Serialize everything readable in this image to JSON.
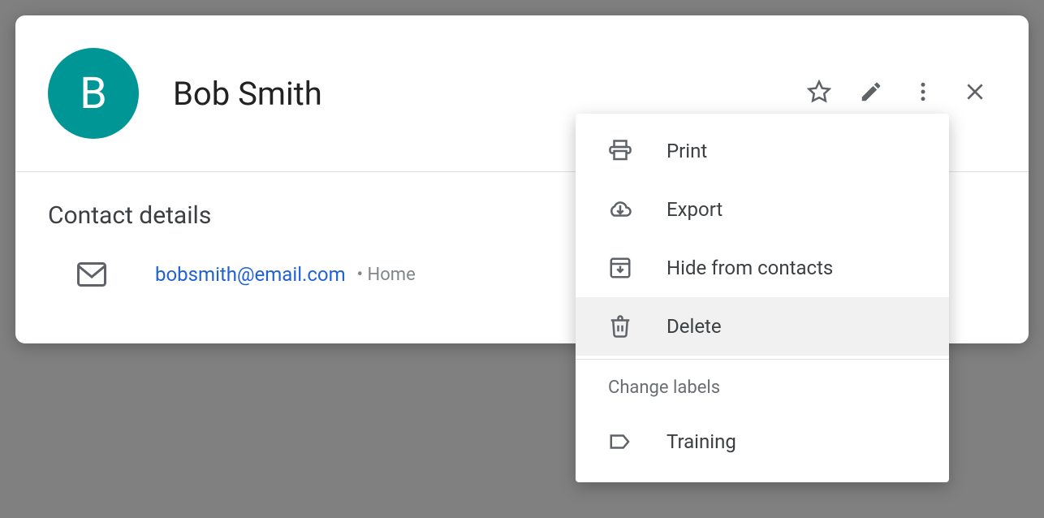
{
  "contact": {
    "initial": "B",
    "name": "Bob Smith"
  },
  "section_title": "Contact details",
  "email": {
    "address": "bobsmith@email.com",
    "type": "Home"
  },
  "menu": {
    "items": [
      {
        "label": "Print"
      },
      {
        "label": "Export"
      },
      {
        "label": "Hide from contacts"
      },
      {
        "label": "Delete"
      }
    ],
    "labels_heading": "Change labels",
    "labels": [
      {
        "label": "Training"
      }
    ]
  }
}
